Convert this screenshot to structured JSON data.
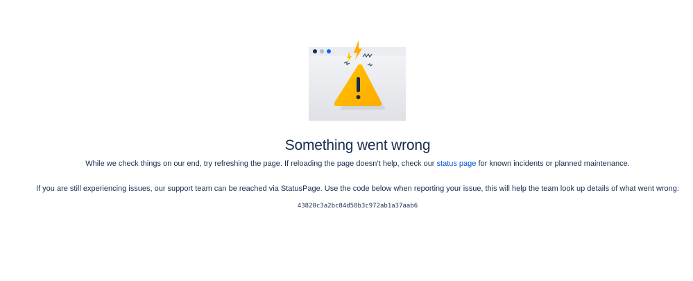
{
  "error": {
    "title": "Something went wrong",
    "message_before_link": "While we check things on our end, try refreshing the page. If reloading the page doesn’t help, check our ",
    "status_link_label": "status page",
    "message_after_link": " for known incidents or planned maintenance.",
    "support_message": "If you are still experiencing issues, our support team can be reached via StatusPage. Use the code below when reporting your issue, this will help the team look up details of what went wrong:",
    "error_code": "43820c3a2bc84d58b3c972ab1a37aab6"
  },
  "illustration": {
    "icon": "warning-triangle-icon",
    "accent_color": "#ffab00",
    "window_dot_colors": [
      "#172b4d",
      "#b3bac5",
      "#0065ff"
    ]
  }
}
